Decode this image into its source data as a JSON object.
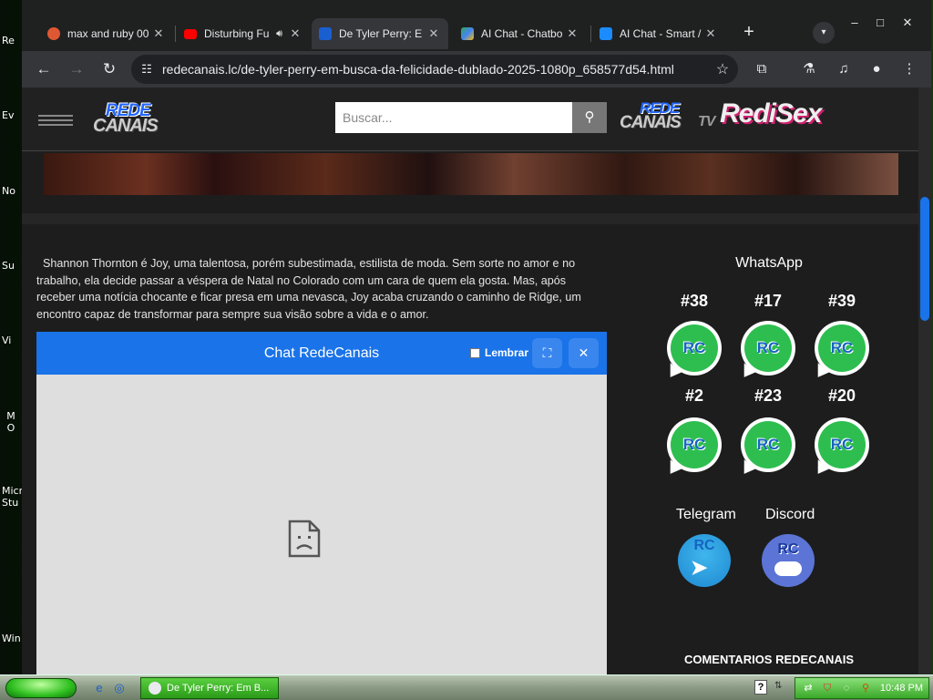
{
  "desktop": {
    "icon_labels": [
      "Re",
      "Ev",
      "No",
      "Su",
      "Vi",
      "M O",
      "Micro Stu",
      "Win"
    ]
  },
  "tabs": [
    {
      "label": "max and ruby 00",
      "favicon": "duckduckgo-icon",
      "color": "#de5833",
      "active": false
    },
    {
      "label": "Disturbing Fu",
      "favicon": "youtube-icon",
      "color": "#ff0000",
      "active": false,
      "audio": true
    },
    {
      "label": "De Tyler Perry: E",
      "favicon": "redecanais-icon",
      "color": "#1a5fd0",
      "active": true
    },
    {
      "label": "AI Chat - Chatbo",
      "favicon": "google-play-icon",
      "color": "#34a853",
      "active": false
    },
    {
      "label": "AI Chat - Smart /",
      "favicon": "app-store-icon",
      "color": "#1a8cff",
      "active": false
    }
  ],
  "window_controls": {
    "minimize": "–",
    "maximize": "□",
    "close": "✕"
  },
  "address_bar": {
    "url": "redecanais.lc/de-tyler-perry-em-busca-da-felicidade-dublado-2025-1080p_658577d54.html"
  },
  "site": {
    "logo_main": {
      "line1": "REDE",
      "line2": "CANAIS"
    },
    "search_placeholder": "Buscar...",
    "logo_tv": {
      "line1": "REDE",
      "line2": "CANAIS",
      "line3": "TV"
    },
    "logo_sex": "RediSex"
  },
  "synopsis": "Shannon Thornton é Joy, uma talentosa, porém subestimada, estilista de moda. Sem sorte no amor e no trabalho, ela decide passar a véspera de Natal no Colorado com um cara de quem ela gosta. Mas, após receber uma notícia chocante e ficar presa em uma nevasca, Joy acaba cruzando o caminho de Ridge, um encontro capaz de transformar para sempre sua visão sobre a vida e o amor.",
  "chat": {
    "title": "Chat RedeCanais",
    "remember_label": "Lembrar",
    "remember_checked": false
  },
  "sidebar": {
    "whatsapp_title": "WhatsApp",
    "groups": [
      "#38",
      "#17",
      "#39",
      "#2",
      "#23",
      "#20"
    ],
    "icon_text": "RC",
    "telegram_label": "Telegram",
    "discord_label": "Discord",
    "comments_heading": "COMENTARIOS REDECANAIS"
  },
  "taskbar": {
    "task_title": "De Tyler Perry: Em B...",
    "clock": "10:48 PM"
  }
}
